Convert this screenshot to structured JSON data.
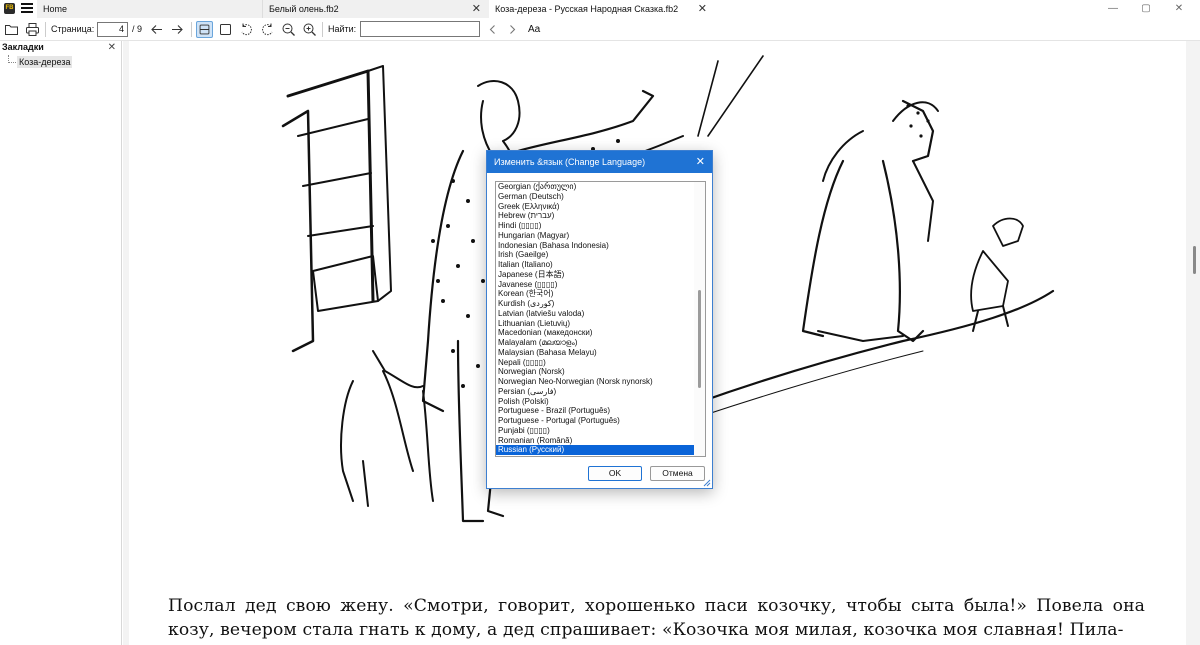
{
  "tabs": [
    {
      "label": "Home"
    },
    {
      "label": "Белый олень.fb2"
    },
    {
      "label": "Коза-дереза - Русская Народная Сказка.fb2"
    }
  ],
  "app_icon_text": "FB",
  "toolbar": {
    "page_label": "Страница:",
    "page_current": "4",
    "page_total": "/ 9",
    "find_label": "Найти:",
    "find_value": "",
    "font_label": "Aa"
  },
  "sidebar": {
    "title": "Закладки",
    "items": [
      {
        "label": "Коза-дереза"
      }
    ]
  },
  "document": {
    "paragraph": "Послал дед свою жену. «Смотри, говорит, хорошенько паси козочку, чтобы сыта была!» Повела она козу, вечером стала гнать к дому, а дед спрашивает: «Козочка моя милая, козочка моя славная! Пила-"
  },
  "dialog": {
    "title": "Изменить &язык (Change Language)",
    "languages": [
      "Georgian (ქართული)",
      "German (Deutsch)",
      "Greek (Ελληνικά)",
      "Hebrew (עברית)",
      "Hindi (▯▯▯▯)",
      "Hungarian (Magyar)",
      "Indonesian (Bahasa Indonesia)",
      "Irish (Gaeilge)",
      "Italian (Italiano)",
      "Japanese (日本語)",
      "Javanese (▯▯▯▯)",
      "Korean (한국어)",
      "Kurdish (کوردی)",
      "Latvian (latviešu valoda)",
      "Lithuanian (Lietuvių)",
      "Macedonian (македонски)",
      "Malayalam (മലയാളം)",
      "Malaysian (Bahasa Melayu)",
      "Nepali (▯▯▯▯)",
      "Norwegian (Norsk)",
      "Norwegian Neo-Norwegian (Norsk nynorsk)",
      "Persian (فارسی)",
      "Polish (Polski)",
      "Portuguese - Brazil (Português)",
      "Portuguese - Portugal (Português)",
      "Punjabi (▯▯▯▯)",
      "Romanian (Română)",
      "Russian (Русский)"
    ],
    "selected_index": 27,
    "ok_label": "OK",
    "cancel_label": "Отмена",
    "accent_color": "#1f73d4"
  }
}
